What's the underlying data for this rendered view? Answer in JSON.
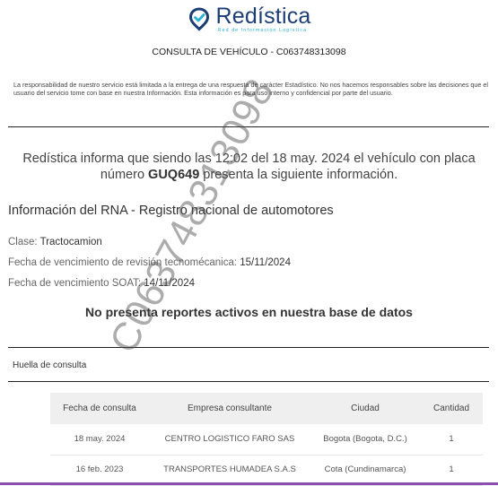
{
  "logo": {
    "name": "Redística",
    "tagline": "Red de Información Logística",
    "brand_color": "#1c3e74",
    "accent_color": "#2bb3d6",
    "icon": "map-pin-check-icon"
  },
  "document": {
    "title": "CONSULTA DE VEHÍCULO - C063748313098",
    "disclaimer": "La responsabilidad de nuestro servicio está limitada a la entrega de una respuesta de carácter Estadístico. No nos hacemos responsables sobre las decisiones que el usuario del servicio tome con base en nuestra Información. Esta información es para uso interno y confidencial por parte del usuario.",
    "lead_before": "Redística informa que siendo las 12:02 del 18 may. 2024 el vehículo con placa número ",
    "plate": "GUQ649",
    "lead_after": " presenta la siguiente información.",
    "watermark": "C063748313098"
  },
  "rna": {
    "section_title": "Información del RNA - Registro nacional de automotores",
    "clase_label": "Clase: ",
    "clase_value": "Tractocamion",
    "tecno_label": "Fecha de vencimiento de revisión tecnomécanica: ",
    "tecno_value": "15/11/2024",
    "soat_label": "Fecha de vencimiento SOAT: ",
    "soat_value": "14/11/2024",
    "no_reports": "No presenta reportes activos en nuestra base de datos"
  },
  "huella": {
    "title": "Huella de consulta",
    "columns": [
      "Fecha de consulta",
      "Empresa consultante",
      "Ciudad",
      "Cantidad"
    ],
    "rows": [
      [
        "18 may. 2024",
        "CENTRO LOGISTICO FARO SAS",
        "Bogota (Bogota, D.C.)",
        "1"
      ],
      [
        "16 feb. 2023",
        "TRANSPORTES HUMADEA S.A.S",
        "Cota (Cundinamarca)",
        "1"
      ]
    ]
  },
  "colors": {
    "bottom_bar": "#8a4fb0"
  }
}
